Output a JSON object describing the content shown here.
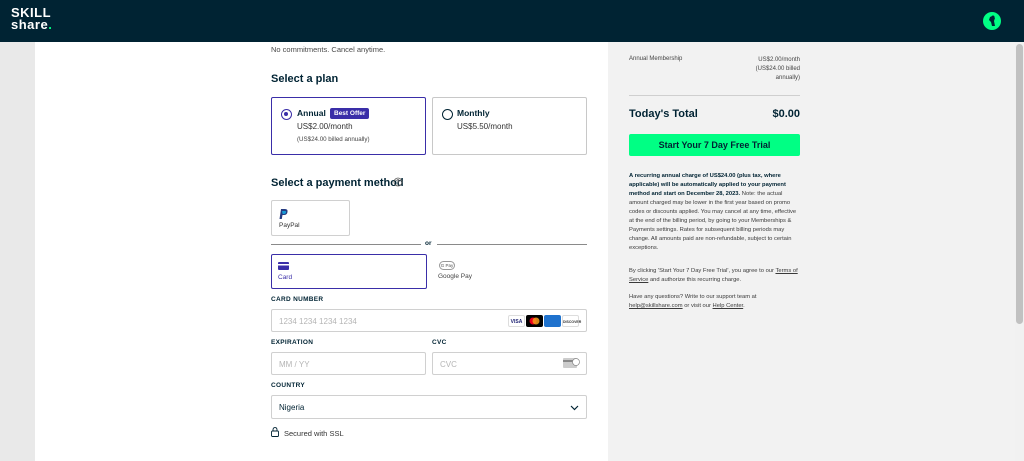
{
  "header": {
    "logo_line1": "SKILL",
    "logo_line2": "share",
    "logo_dot": "."
  },
  "main": {
    "tagline": "No commitments. Cancel anytime.",
    "select_plan_heading": "Select a plan",
    "plans": [
      {
        "name": "Annual",
        "badge": "Best Offer",
        "price": "US$2.00/month",
        "note": "(US$24.00 billed annually)",
        "selected": true
      },
      {
        "name": "Monthly",
        "price": "US$5.50/month",
        "selected": false
      }
    ],
    "payment_heading": "Select a payment method",
    "methods": {
      "paypal": "PayPal",
      "or": "or",
      "card": "Card",
      "gpay": "Google Pay",
      "gpay_icon": "G Pay"
    },
    "card_number": {
      "label": "CARD NUMBER",
      "placeholder": "1234 1234 1234 1234"
    },
    "card_brands": [
      "VISA",
      "MC",
      "AMEX",
      "DISCOVER"
    ],
    "expiration": {
      "label": "EXPIRATION",
      "placeholder": "MM / YY"
    },
    "cvc": {
      "label": "CVC",
      "placeholder": "CVC"
    },
    "country": {
      "label": "COUNTRY",
      "value": "Nigeria"
    },
    "ssl": "Secured with SSL"
  },
  "summary": {
    "membership_label": "Annual Membership",
    "membership_price_1": "US$2.00/month",
    "membership_price_2": "(US$24.00 billed",
    "membership_price_3": "annually)",
    "total_label": "Today's Total",
    "total_value": "$0.00",
    "cta": "Start Your 7 Day Free Trial",
    "legal_bold": "A recurring annual charge of US$24.00 (plus tax, where applicable) will be automatically applied to your payment method and start on December 28, 2023.",
    "legal_note": "Note: the actual amount charged may be lower in the first year based on promo codes or discounts applied. You may cancel at any time, effective at the end of the billing period, by going to your Memberships & Payments settings. Rates for subsequent billing periods may change. All amounts paid are non-refundable, subject to certain exceptions.",
    "agree_1": "By clicking 'Start Your 7 Day Free Trial', you agree to our",
    "terms_link": "Terms of Service",
    "agree_2": " and authorize this recurring charge.",
    "questions": "Have any questions? Write to our support team at",
    "email_link": "help@skillshare.com",
    "or_visit": " or visit our ",
    "help_link": "Help Center",
    "period": "."
  },
  "colors": {
    "brand_dark": "#002333",
    "accent_green": "#00ff84",
    "selected_purple": "#3a2ea8"
  }
}
